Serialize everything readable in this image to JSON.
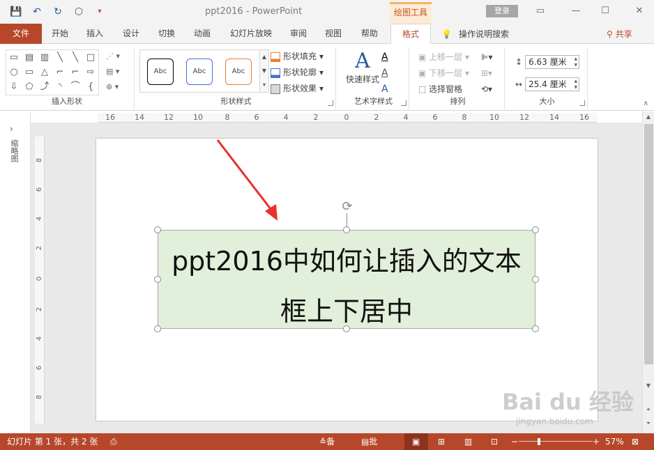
{
  "window": {
    "title": "ppt2016  -  PowerPoint",
    "context_tool": "绘图工具",
    "login": "登录",
    "controls": [
      "▭",
      "—",
      "☐",
      "✕"
    ]
  },
  "quick_access": {
    "save": "💾",
    "undo": "↶",
    "redo": "↻",
    "present": "⬡",
    "more": "▾"
  },
  "tabs": [
    "文件",
    "开始",
    "插入",
    "设计",
    "切换",
    "动画",
    "幻灯片放映",
    "审阅",
    "视图",
    "帮助",
    "格式"
  ],
  "search": {
    "icon": "💡",
    "label": "操作说明搜索"
  },
  "share": {
    "icon": "⚲",
    "label": "共享"
  },
  "ribbon": {
    "insert_shapes": {
      "label": "插入形状",
      "shapes": [
        "▭",
        "▤",
        "▥",
        "╲",
        "╲",
        "□",
        "○",
        "▭",
        "△",
        "⌐",
        "⌐",
        "⇨",
        "⇩",
        "⬠",
        "⤴",
        "◝",
        "⌒",
        "{"
      ],
      "side": [
        "⋰ ▾",
        "▤ ▾",
        "⊛ ▾"
      ]
    },
    "shape_styles": {
      "label": "形状样式",
      "items": [
        "Abc",
        "Abc",
        "Abc"
      ],
      "item_colors": [
        "#000000",
        "#4472c4",
        "#ed7d31"
      ],
      "fill": "形状填充",
      "outline": "形状轮廓",
      "effects": "形状效果"
    },
    "wordart": {
      "label": "艺术字样式",
      "quick": "快速样式",
      "glyph": "A"
    },
    "arrange": {
      "label": "排列",
      "forward": "上移一层",
      "backward": "下移一层",
      "pane": "选择窗格"
    },
    "size": {
      "label": "大小",
      "height": "6.63 厘米",
      "width": "25.4 厘米"
    }
  },
  "rulers": {
    "horizontal": [
      "16",
      "14",
      "12",
      "10",
      "8",
      "6",
      "4",
      "2",
      "0",
      "2",
      "4",
      "6",
      "8",
      "10",
      "12",
      "14",
      "16"
    ],
    "vertical": [
      "8",
      "6",
      "4",
      "2",
      "0",
      "2",
      "4",
      "6",
      "8"
    ]
  },
  "thumbnails": {
    "toggle": "›",
    "label": "缩略图"
  },
  "slide": {
    "text_line1": "ppt2016中如何让插入的文本",
    "text_line2": "框上下居中"
  },
  "watermark": {
    "brand": "Bai du 经验",
    "url": "jingyan.baidu.com"
  },
  "status": {
    "slide_info": "幻灯片 第 1 张，共 2 张",
    "notes": "备注",
    "comments": "批注",
    "zoom": "57%"
  }
}
